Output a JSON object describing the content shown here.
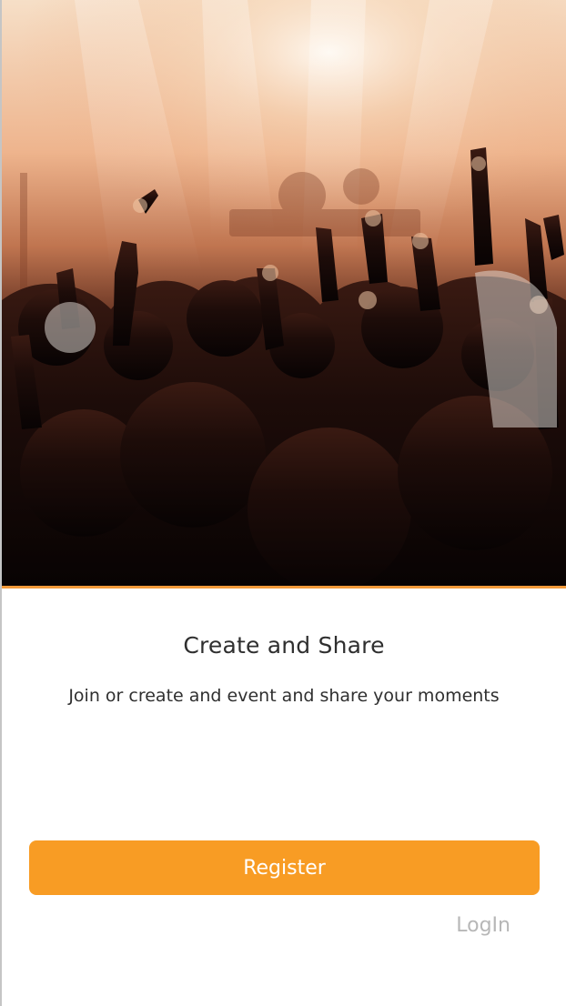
{
  "hero": {
    "image_name": "concert-crowd-image"
  },
  "onboarding": {
    "title": "Create and Share",
    "subtitle": "Join or create and event and share your moments"
  },
  "actions": {
    "register_label": "Register",
    "login_label": "LogIn"
  },
  "colors": {
    "accent": "#f89c24",
    "divider": "#f39a3a",
    "text_primary": "#2f2f2f",
    "text_muted": "#b7b7b7",
    "background": "#ffffff"
  }
}
